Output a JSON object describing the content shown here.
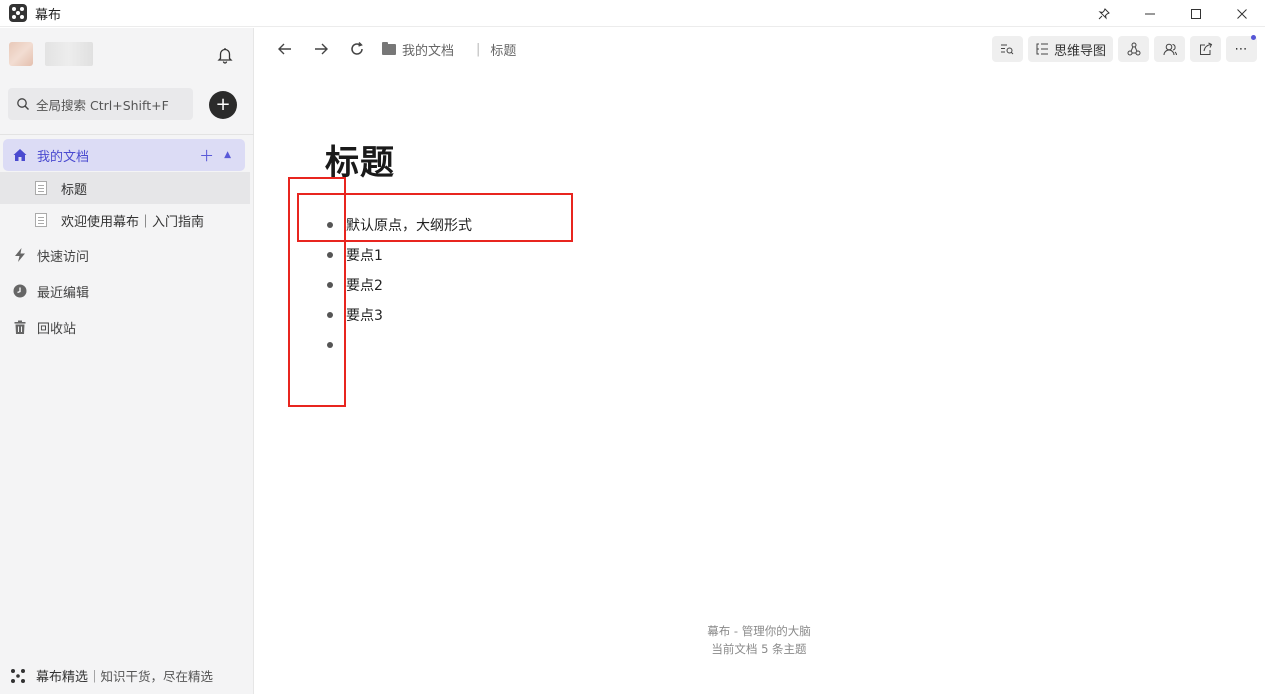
{
  "window": {
    "title": "幕布",
    "controls": [
      "pin",
      "minimize",
      "maximize",
      "close"
    ]
  },
  "sidebar": {
    "search_placeholder": "全局搜索 Ctrl+Shift+F",
    "nav": {
      "my_docs": "我的文档",
      "quick_access": "快速访问",
      "recent_edits": "最近编辑",
      "recycle_bin": "回收站"
    },
    "documents": [
      {
        "label": "标题"
      },
      {
        "label": "欢迎使用幕布｜入门指南"
      }
    ],
    "featured": {
      "title": "幕布精选",
      "separator": "｜",
      "subtitle": "知识干货，尽在精选"
    }
  },
  "toolbar": {
    "breadcrumb": {
      "folder": "我的文档",
      "separator": "|",
      "current": "标题"
    },
    "mindmap_label": "思维导图"
  },
  "document": {
    "title": "标题",
    "items": [
      "默认原点，大纲形式",
      "要点1",
      "要点2",
      "要点3",
      ""
    ]
  },
  "footer": {
    "line1": "幕布 - 管理你的大脑",
    "line2": "当前文档 5 条主题"
  },
  "colors": {
    "accent": "#4a4ad0",
    "active_bg": "#dcdcf5",
    "annotation_red": "#e8251f"
  }
}
